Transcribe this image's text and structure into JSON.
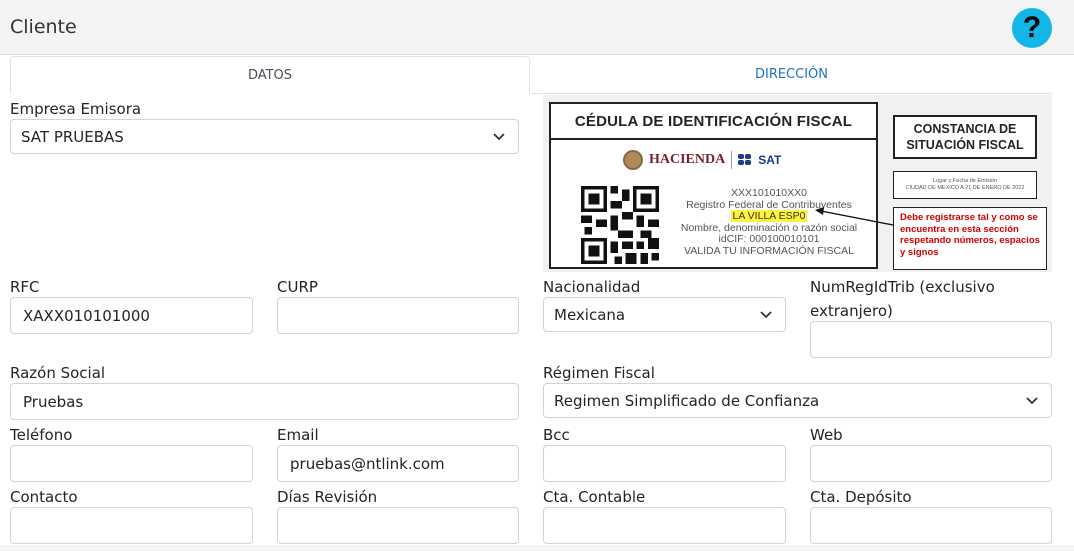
{
  "header": {
    "title": "Cliente",
    "help_label": "?"
  },
  "tabs": {
    "datos": "DATOS",
    "direccion": "DIRECCIÓN"
  },
  "form": {
    "empresa_emisora": {
      "label": "Empresa Emisora",
      "value": "SAT PRUEBAS"
    },
    "rfc": {
      "label": "RFC",
      "value": "XAXX010101000"
    },
    "curp": {
      "label": "CURP",
      "value": ""
    },
    "nacionalidad": {
      "label": "Nacionalidad",
      "value": "Mexicana"
    },
    "numregidtrib": {
      "label_line1": "NumRegIdTrib (exclusivo",
      "label_line2": "extranjero)",
      "value": ""
    },
    "razon_social": {
      "label": "Razón Social",
      "value": "Pruebas"
    },
    "regimen_fiscal": {
      "label": "Régimen Fiscal",
      "value": "Regimen Simplificado de Confianza"
    },
    "telefono": {
      "label": "Teléfono",
      "value": ""
    },
    "email": {
      "label": "Email",
      "value": "pruebas@ntlink.com"
    },
    "bcc": {
      "label": "Bcc",
      "value": ""
    },
    "web": {
      "label": "Web",
      "value": ""
    },
    "contacto": {
      "label": "Contacto",
      "value": ""
    },
    "dias_revision": {
      "label": "Días Revisión",
      "value": ""
    },
    "cta_contable": {
      "label": "Cta. Contable",
      "value": ""
    },
    "cta_deposito": {
      "label": "Cta. Depósito",
      "value": ""
    }
  },
  "cedula": {
    "title": "CÉDULA DE IDENTIFICACIÓN FISCAL",
    "hacienda": "HACIENDA",
    "sat": "SAT",
    "rfc_line": "XXX101010XX0",
    "registro": "Registro Federal de Contribuyentes",
    "highlight": "LA VILLA ESP0",
    "nombre": "Nombre, denominación o razón social",
    "idcif": "idCIF: 000100010101",
    "valida": "VALIDA TU INFORMACIÓN FISCAL",
    "constancia": "CONSTANCIA DE SITUACIÓN FISCAL",
    "lugar_title": "Lugar y Fecha de Emisión",
    "lugar_value": "CIUDAD DE MEXICO A 21 DE ENERO DE 2022",
    "note": "Debe registrarse tal y como se encuentra en esta sección respetando números, espacios y signos"
  },
  "colors": {
    "help_button": "#12b7e8",
    "tab_active_text": "#495057",
    "tab_link": "#1a73c8",
    "note_text": "#d40000",
    "highlight": "#fff23a"
  },
  "icons": {
    "help": "question-icon",
    "dropdown": "chevron-down-icon"
  }
}
